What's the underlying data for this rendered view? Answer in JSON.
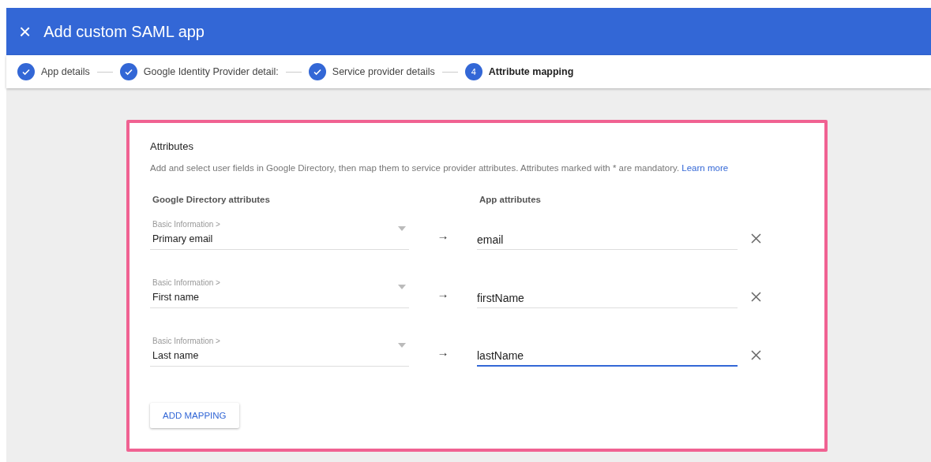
{
  "header": {
    "close": "×",
    "title": "Add custom SAML app"
  },
  "steps": [
    {
      "label": "App details",
      "completed": true,
      "active": false
    },
    {
      "label": "Google Identity Provider detail:",
      "completed": true,
      "active": false
    },
    {
      "label": "Service provider details",
      "completed": true,
      "active": false
    },
    {
      "label": "Attribute mapping",
      "number": "4",
      "completed": false,
      "active": true
    }
  ],
  "card": {
    "title": "Attributes",
    "description": "Add and select user fields in Google Directory, then map them to service provider attributes. Attributes marked with * are mandatory.",
    "link": "Learn more",
    "left_heading": "Google Directory attributes",
    "right_heading": "App attributes",
    "mappings": [
      {
        "category": "Basic Information >",
        "field": "Primary email",
        "arrow": "→",
        "value": "email",
        "focused": false
      },
      {
        "category": "Basic Information >",
        "field": "First name",
        "arrow": "→",
        "value": "firstName",
        "focused": false
      },
      {
        "category": "Basic Information >",
        "field": "Last name",
        "arrow": "→",
        "value": "lastName",
        "focused": true
      }
    ],
    "button": "ADD MAPPING"
  }
}
